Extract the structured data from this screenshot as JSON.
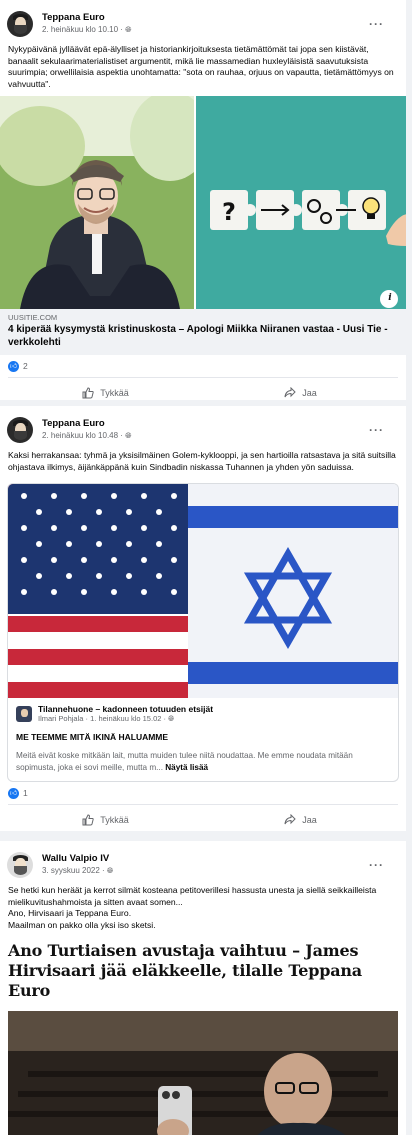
{
  "posts": [
    {
      "author": "Teppana Euro",
      "time": "2. heinäkuu klo 10.10 · ",
      "text": "Nykypäivänä jylläävät epä-älylliset ja historiankirjoituksesta tietämättömät tai jopa sen kiistävät, banaalit sekulaarimaterialistiset argumentit, mikä lie massamedian huxleyläisistä saavutuksista suurimpia; orwellilaisia aspektia unohtamatta: \"sota on rauhaa, orjuus on vapautta, tietämättömyys on vahvuutta\".",
      "link_domain": "UUSITIE.COM",
      "link_title": "4 kiperää kysymystä kristinuskosta – Apologi Miikka Niiranen vastaa - Uusi Tie -verkkolehti",
      "reactions": "2",
      "like_label": "Tykkää",
      "share_label": "Jaa",
      "info_icon": "i"
    },
    {
      "author": "Teppana Euro",
      "time": "2. heinäkuu klo 10.48 · ",
      "text": "Kaksi herrakansaa: tyhmä ja yksisilmäinen Golem-kyklooppi, ja sen hartioilla ratsastava ja sitä suitsilla ohjastava ilkimys, äijänkäppänä kuin Sindbadin niskassa Tuhannen ja yhden yön saduissa.",
      "shared_author": "Tilannehuone – kadonneen totuuden etsijät",
      "shared_sub": "Ilmari Pohjala · 1. heinäkuu klo 15.02 · ",
      "shared_title": "ME TEEMME MITÄ IKINÄ HALUAMME",
      "shared_text": "Meitä eivät koske mitkään lait, mutta muiden tulee niitä noudattaa. Me emme noudata mitään sopimusta, joka ei sovi meille, mutta m...",
      "see_more": "Näytä lisää",
      "reactions": "1",
      "like_label": "Tykkää",
      "share_label": "Jaa"
    },
    {
      "author": "Wallu Valpio IV",
      "time": "3. syyskuu 2022 · ",
      "text_lines": [
        "Se hetki kun heräät ja kerrot silmät kosteana petitoverillesi hassusta unesta ja siellä seikkailleista mielikuvitushahmoista ja sitten avaat somen...",
        "Ano, Hirvisaari ja Teppana Euro.",
        "Maailman on pakko olla yksi iso sketsi."
      ],
      "headline": "Ano Turtiaisen avustaja vaihtuu – James Hirvisaari jää eläkkeelle, tilalle Teppana Euro"
    }
  ],
  "more_icon": "···",
  "colors": {
    "accent": "#1877f2",
    "secondary_text": "#65676b",
    "background": "#f0f2f5"
  }
}
